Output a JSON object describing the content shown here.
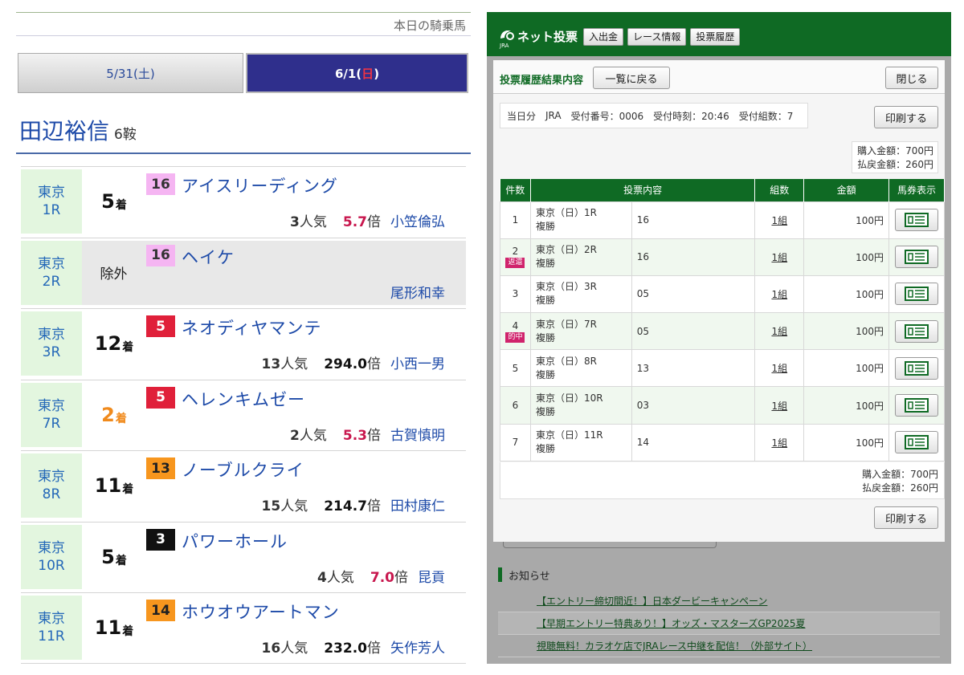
{
  "left": {
    "header": "本日の騎乗馬",
    "date_tabs": [
      {
        "label": "5/31(土)"
      },
      {
        "label_pre": "6/1(",
        "label_day": "日",
        "label_post": ")"
      }
    ],
    "jockey": {
      "name": "田辺裕信",
      "rides": "6鞍"
    },
    "races": [
      {
        "venue": "東京",
        "race": "1R",
        "place": "5",
        "place_suffix": "着",
        "num": "16",
        "num_color": "pink",
        "horse": "アイスリーディング",
        "pop_num": "3",
        "pop_suffix": "人気",
        "odds": "5.7",
        "odds_suffix": "倍",
        "odds_color": "red",
        "rider": "小笠倫弘"
      },
      {
        "venue": "東京",
        "race": "2R",
        "place": "除外",
        "place_suffix": "",
        "num": "16",
        "num_color": "pink",
        "horse": "ヘイケ",
        "pop_num": "",
        "pop_suffix": "",
        "odds": "",
        "odds_suffix": "",
        "odds_color": "black",
        "rider": "尾形和幸"
      },
      {
        "venue": "東京",
        "race": "3R",
        "place": "12",
        "place_suffix": "着",
        "num": "5",
        "num_color": "red",
        "horse": "ネオディヤマンテ",
        "pop_num": "13",
        "pop_suffix": "人気",
        "odds": "294.0",
        "odds_suffix": "倍",
        "odds_color": "black",
        "rider": "小西一男"
      },
      {
        "venue": "東京",
        "race": "7R",
        "place": "2",
        "place_suffix": "着",
        "num": "5",
        "num_color": "red",
        "horse": "ヘレンキムゼー",
        "pop_num": "2",
        "pop_suffix": "人気",
        "odds": "5.3",
        "odds_suffix": "倍",
        "odds_color": "red",
        "rider": "古賀慎明"
      },
      {
        "venue": "東京",
        "race": "8R",
        "place": "11",
        "place_suffix": "着",
        "num": "13",
        "num_color": "orange",
        "horse": "ノーブルクライ",
        "pop_num": "15",
        "pop_suffix": "人気",
        "odds": "214.7",
        "odds_suffix": "倍",
        "odds_color": "black",
        "rider": "田村康仁"
      },
      {
        "venue": "東京",
        "race": "10R",
        "place": "5",
        "place_suffix": "着",
        "num": "3",
        "num_color": "black",
        "horse": "パワーホール",
        "pop_num": "4",
        "pop_suffix": "人気",
        "odds": "7.0",
        "odds_suffix": "倍",
        "odds_color": "red",
        "rider": "昆貢"
      },
      {
        "venue": "東京",
        "race": "11R",
        "place": "11",
        "place_suffix": "着",
        "num": "14",
        "num_color": "orange",
        "horse": "ホウオウアートマン",
        "pop_num": "16",
        "pop_suffix": "人気",
        "odds": "232.0",
        "odds_suffix": "倍",
        "odds_color": "black",
        "rider": "矢作芳人"
      }
    ]
  },
  "right": {
    "logo_sub": "JRA",
    "title": "ネット投票",
    "tabs": [
      "入出金",
      "レース情報",
      "投票履歴"
    ],
    "modal": {
      "title": "投票履歴結果内容",
      "back_button": "一覧に戻る",
      "close_button": "閉じる",
      "info": [
        "当日分",
        "JRA",
        "受付番号：0006",
        "受付時刻：20:46",
        "受付組数：7"
      ],
      "print_button": "印刷する",
      "purchase": "購入金額：700円",
      "refund": "払戻金額：260円",
      "columns": [
        "件数",
        "投票内容",
        "組数",
        "金額",
        "馬券表示"
      ],
      "rows": [
        {
          "no": "1",
          "badge": "",
          "race": "東京（日）1R",
          "type": "複勝",
          "nums": "16",
          "kumi": "1組",
          "amount": "100円"
        },
        {
          "no": "2",
          "badge": "返還",
          "race": "東京（日）2R",
          "type": "複勝",
          "nums": "16",
          "kumi": "1組",
          "amount": "100円"
        },
        {
          "no": "3",
          "badge": "",
          "race": "東京（日）3R",
          "type": "複勝",
          "nums": "05",
          "kumi": "1組",
          "amount": "100円"
        },
        {
          "no": "4",
          "badge": "的中",
          "race": "東京（日）7R",
          "type": "複勝",
          "nums": "05",
          "kumi": "1組",
          "amount": "100円"
        },
        {
          "no": "5",
          "badge": "",
          "race": "東京（日）8R",
          "type": "複勝",
          "nums": "13",
          "kumi": "1組",
          "amount": "100円"
        },
        {
          "no": "6",
          "badge": "",
          "race": "東京（日）10R",
          "type": "複勝",
          "nums": "03",
          "kumi": "1組",
          "amount": "100円"
        },
        {
          "no": "7",
          "badge": "",
          "race": "東京（日）11R",
          "type": "複勝",
          "nums": "14",
          "kumi": "1組",
          "amount": "100円"
        }
      ]
    },
    "news": {
      "title": "お知らせ",
      "items": [
        "【エントリー締切間近！】日本ダービーキャンペーン",
        "【早期エントリー特典あり！】オッズ・マスターズGP2025夏",
        "視聴無料！カラオケ店でJRAレース中継を配信！（外部サイト）"
      ]
    },
    "colors": {
      "green": "#0f6a24",
      "badge": "#d0236c",
      "odds_red": "#c8174e",
      "place2": "#f08a1c"
    }
  }
}
